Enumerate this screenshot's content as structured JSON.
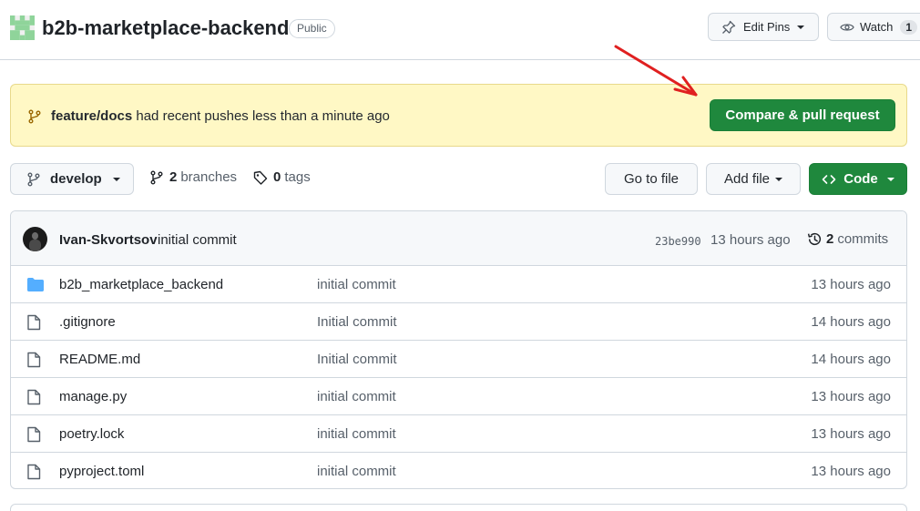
{
  "header": {
    "repo_name": "b2b-marketplace-backend",
    "visibility": "Public",
    "edit_pins_label": "Edit Pins",
    "watch_label": "Watch",
    "watch_count": "1"
  },
  "banner": {
    "branch": "feature/docs",
    "message": "had recent pushes less than a minute ago",
    "button_label": "Compare & pull request"
  },
  "toolbar": {
    "branch": "develop",
    "branches_count": "2",
    "branches_label": "branches",
    "tags_count": "0",
    "tags_label": "tags",
    "goto_file_label": "Go to file",
    "add_file_label": "Add file",
    "code_label": "Code"
  },
  "latest_commit": {
    "author": "Ivan-Skvortsov",
    "message": "initial commit",
    "sha": "23be990",
    "time": "13 hours ago",
    "commits_count": "2",
    "commits_label": "commits"
  },
  "files": [
    {
      "name": "b2b_marketplace_backend",
      "type": "folder",
      "message": "initial commit",
      "time": "13 hours ago"
    },
    {
      "name": ".gitignore",
      "type": "file",
      "message": "Initial commit",
      "time": "14 hours ago"
    },
    {
      "name": "README.md",
      "type": "file",
      "message": "Initial commit",
      "time": "14 hours ago"
    },
    {
      "name": "manage.py",
      "type": "file",
      "message": "initial commit",
      "time": "13 hours ago"
    },
    {
      "name": "poetry.lock",
      "type": "file",
      "message": "initial commit",
      "time": "13 hours ago"
    },
    {
      "name": "pyproject.toml",
      "type": "file",
      "message": "initial commit",
      "time": "13 hours ago"
    }
  ],
  "colors": {
    "primary_green": "#1f883d",
    "banner_bg": "#fff8c5",
    "folder_blue": "#54aeff",
    "annotation_red": "#e02020"
  }
}
